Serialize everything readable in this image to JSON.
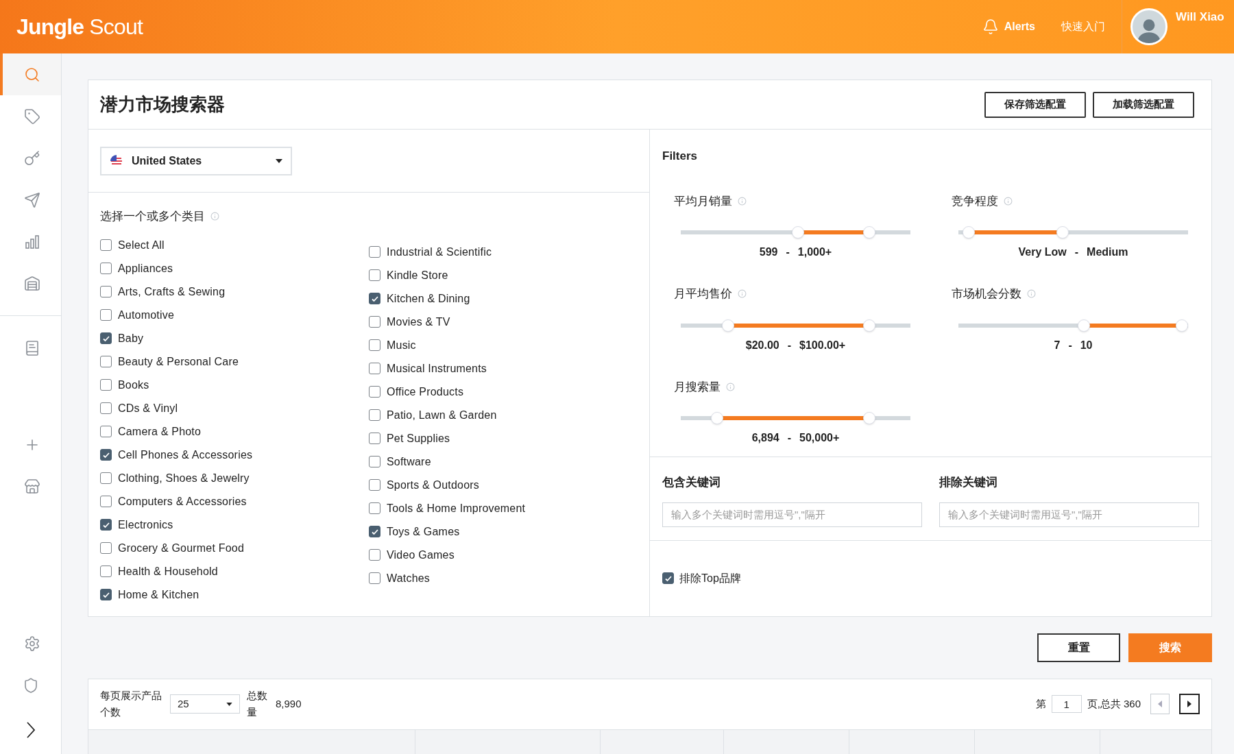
{
  "header": {
    "logo": {
      "primary": "Jungle",
      "secondary": "Scout"
    },
    "alerts": "Alerts",
    "quick_start": "快速入门",
    "user": "Will Xiao"
  },
  "sidebar": {
    "items": [
      {
        "selected": true
      },
      {
        "selected": false
      },
      {
        "selected": false
      },
      {
        "selected": false
      },
      {
        "selected": false
      },
      {
        "selected": false
      }
    ],
    "bottom_items": [
      {
        "selected": false
      },
      {
        "selected": false
      },
      {
        "selected": false
      },
      {
        "selected": false
      }
    ]
  },
  "page": {
    "title": "潜力市场搜索器",
    "buttons": [
      "保存筛选配置",
      "加载筛选配置"
    ]
  },
  "country": {
    "value": "United States"
  },
  "categories": {
    "label": "选择一个或多个类目",
    "columns": [
      [
        {
          "label": "Select All",
          "checked": false
        },
        {
          "label": "Appliances",
          "checked": false
        },
        {
          "label": "Arts, Crafts & Sewing",
          "checked": false
        },
        {
          "label": "Automotive",
          "checked": false
        },
        {
          "label": "Baby",
          "checked": true
        },
        {
          "label": "Beauty & Personal Care",
          "checked": false
        },
        {
          "label": "Books",
          "checked": false
        },
        {
          "label": "CDs & Vinyl",
          "checked": false
        },
        {
          "label": "Camera & Photo",
          "checked": false
        },
        {
          "label": "Cell Phones & Accessories",
          "checked": true
        },
        {
          "label": "Clothing, Shoes & Jewelry",
          "checked": false
        },
        {
          "label": "Computers & Accessories",
          "checked": false
        },
        {
          "label": "Electronics",
          "checked": true
        },
        {
          "label": "Grocery & Gourmet Food",
          "checked": false
        },
        {
          "label": "Health & Household",
          "checked": false
        },
        {
          "label": "Home & Kitchen",
          "checked": true
        }
      ],
      [
        {
          "label": "Industrial & Scientific",
          "checked": false
        },
        {
          "label": "Kindle Store",
          "checked": false
        },
        {
          "label": "Kitchen & Dining",
          "checked": true
        },
        {
          "label": "Movies & TV",
          "checked": false
        },
        {
          "label": "Music",
          "checked": false
        },
        {
          "label": "Musical Instruments",
          "checked": false
        },
        {
          "label": "Office Products",
          "checked": false
        },
        {
          "label": "Patio, Lawn & Garden",
          "checked": false
        },
        {
          "label": "Pet Supplies",
          "checked": false
        },
        {
          "label": "Software",
          "checked": false
        },
        {
          "label": "Sports & Outdoors",
          "checked": false
        },
        {
          "label": "Tools & Home Improvement",
          "checked": false
        },
        {
          "label": "Toys & Games",
          "checked": true
        },
        {
          "label": "Video Games",
          "checked": false
        },
        {
          "label": "Watches",
          "checked": false
        }
      ]
    ]
  },
  "filters": {
    "title": "Filters",
    "sliders": [
      {
        "label": "平均月销量",
        "handles": [
          {
            "level": 0.51
          },
          {
            "level": 0.84
          }
        ],
        "low": "599",
        "separator": "-",
        "high": "1,000+"
      },
      {
        "label": "竞争程度",
        "handles": [
          {
            "level": 0.02
          },
          {
            "level": 0.45
          }
        ],
        "low": "Very Low",
        "separator": "-",
        "high": "Medium"
      },
      {
        "label": "月平均售价",
        "handles": [
          {
            "level": 0.19
          },
          {
            "level": 0.84
          }
        ],
        "low": "$20.00",
        "separator": "-",
        "high": "$100.00+"
      },
      {
        "label": "市场机会分数",
        "handles": [
          {
            "level": 0.55
          },
          {
            "level": 1.0
          }
        ],
        "low": "7",
        "separator": "-",
        "high": "10"
      },
      {
        "label": "月搜索量",
        "handles": [
          {
            "level": 0.14
          },
          {
            "level": 0.84
          }
        ],
        "low": "6,894",
        "separator": "-",
        "high": "50,000+"
      }
    ]
  },
  "keywords": [
    {
      "label": "包含关键词",
      "placeholder": "输入多个关键词时需用逗号\",\"隔开"
    },
    {
      "label": "排除关键词",
      "placeholder": "输入多个关键词时需用逗号\",\"隔开"
    }
  ],
  "exclude_top_brands": {
    "label": "排除Top品牌",
    "checked": true
  },
  "actions": {
    "reset": "重置",
    "search": "搜索"
  },
  "pager": {
    "per_page_label": "每页展示产品个数",
    "per_page": "25",
    "total_label": "总数量",
    "total": "8,990",
    "page_prefix": "第",
    "page": "1",
    "page_suffix": "页,总共 360"
  }
}
